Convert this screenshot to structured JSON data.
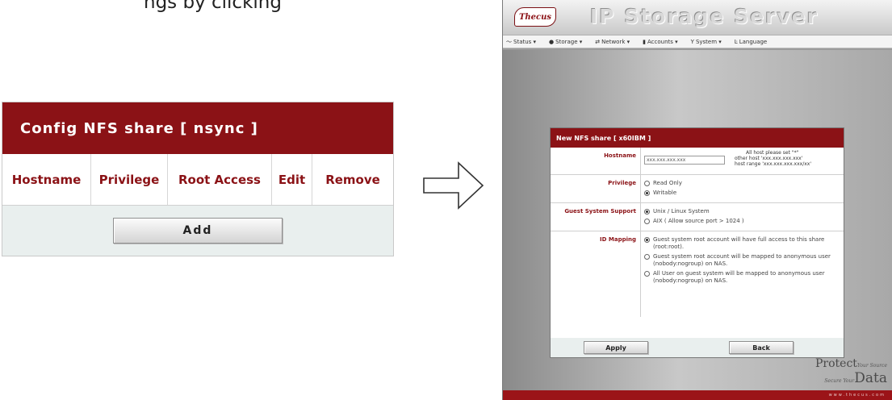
{
  "caption": "ngs by clicking",
  "nfs_panel": {
    "title": "Config NFS share [ nsync ]",
    "columns": [
      "Hostname",
      "Privilege",
      "Root Access",
      "Edit",
      "Remove"
    ],
    "add_label": "Add"
  },
  "thecus": {
    "logo": "Thecus",
    "title": "IP Storage Server",
    "nav": [
      {
        "icon": "status-icon",
        "label": "Status ▾"
      },
      {
        "icon": "storage-icon",
        "label": "Storage ▾"
      },
      {
        "icon": "network-icon",
        "label": "Network ▾"
      },
      {
        "icon": "accounts-icon",
        "label": "Accounts ▾"
      },
      {
        "icon": "system-icon",
        "label": "System ▾"
      },
      {
        "icon": "language-icon",
        "label": "Language"
      }
    ],
    "form": {
      "title": "New NFS share [ x60IBM ]",
      "hostname_label": "Hostname",
      "hostname_value": "xxx.xxx.xxx.xxx",
      "hostname_hint": [
        "All host please set \"*\"",
        "other host 'xxx.xxx.xxx.xxx'",
        "host range 'xxx.xxx.xxx.xxx/xx'"
      ],
      "privilege_label": "Privilege",
      "privilege_options": [
        "Read Only",
        "Writable"
      ],
      "guest_label": "Guest System Support",
      "guest_options": [
        "Unix / Linux System",
        "AIX ( Allow source port > 1024 )"
      ],
      "idmap_label": "ID Mapping",
      "idmap_options": [
        "Guest system root account will have full access to this share (root:root).",
        "Guest system root account will be mapped to anonymous user (nobody:nogroup) on NAS.",
        "All User on guest system will be mapped to anonymous user (nobody:nogroup) on NAS."
      ],
      "apply_label": "Apply",
      "back_label": "Back"
    },
    "protect": {
      "word1": "Protect",
      "tag1": "Your Source",
      "tag2": "Secure Your",
      "word2": "Data"
    },
    "url": "www.thecus.com"
  }
}
